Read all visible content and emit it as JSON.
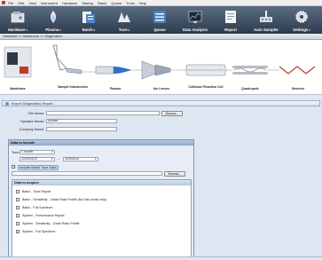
{
  "menu": [
    "File",
    "Edit",
    "View",
    "Instrument",
    "Hardware",
    "Startup",
    "Batch",
    "Queue",
    "Tools",
    "Help"
  ],
  "toolbar": [
    {
      "label": "Hardware",
      "icon": "hardware-icon",
      "dropdown": true
    },
    {
      "label": "Plasma",
      "icon": "plasma-icon",
      "dropdown": true
    },
    {
      "label": "Batch",
      "icon": "batch-icon",
      "dropdown": true
    },
    {
      "label": "Tune",
      "icon": "tune-icon",
      "dropdown": true
    },
    {
      "label": "Queue",
      "icon": "queue-icon",
      "dropdown": false
    },
    {
      "label": "Data Analysis",
      "icon": "data-analysis-icon",
      "dropdown": false
    },
    {
      "label": "Report",
      "icon": "report-icon",
      "dropdown": false
    },
    {
      "label": "Auto Sampler",
      "icon": "auto-sampler-icon",
      "dropdown": false
    },
    {
      "label": "Settings",
      "icon": "settings-icon",
      "dropdown": true
    }
  ],
  "breadcrumb": "Hardware >> Mainframe >> Diagnostics",
  "diagram_labels": [
    "Mainframe",
    "Sample Introduction",
    "Plasma",
    "Ion Lenses",
    "Collision/ Reaction Cell",
    "Quadrupole",
    "Detector"
  ],
  "pane": {
    "title": "Export Diagnostics Report",
    "file_name_label": "File Name:",
    "file_name_value": "",
    "operator_label": "Operator Name:",
    "operator_value": "icpuser",
    "company_label": "Company Name:",
    "company_value": "",
    "browse": "Browse..."
  },
  "data_include": {
    "title": "Data to Include",
    "term_label": "Term:",
    "term_value": "1 month",
    "date_from": "12/20/2013",
    "date_to": "1/20/2014",
    "include_batch_label": "Include Batch Tune Data",
    "browse": "Browse..."
  },
  "data_acquire": {
    "title": "Data to Acquire",
    "items": [
      "Batch - Tune Report",
      "Batch - Sensitivity - Oxide Ratio Profile (No Gas mode only)",
      "Batch - Full Spectrum",
      "System - Performance Report",
      "System - Sensitivity - Oxide Ratio Profile",
      "System - Full Spectrum"
    ]
  },
  "colors": {
    "toolbar": "#2c3a4c",
    "accent": "#2a6ab0"
  }
}
